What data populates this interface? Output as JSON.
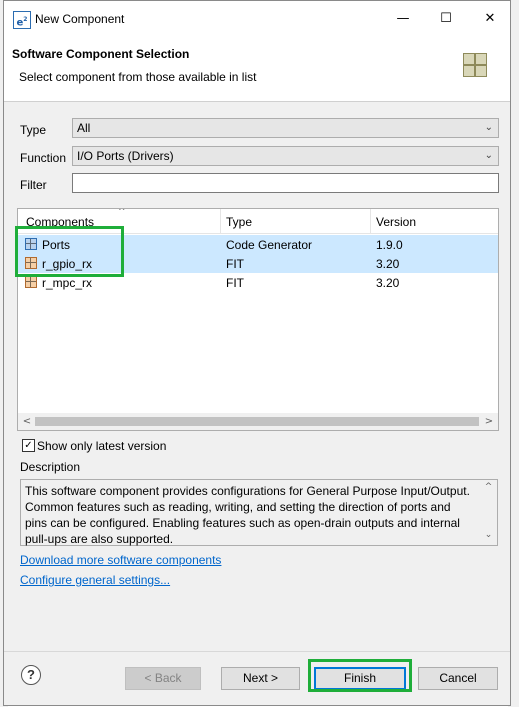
{
  "window": {
    "title": "New Component",
    "app_icon": "e²",
    "controls": {
      "minimize": "—",
      "maximize": "☐",
      "close": "✕"
    }
  },
  "header": {
    "title": "Software Component Selection",
    "description": "Select component from those available in list"
  },
  "filters": {
    "type_label": "Type",
    "type_value": "All",
    "function_label": "Function",
    "function_value": "I/O Ports (Drivers)",
    "filter_label": "Filter",
    "filter_value": ""
  },
  "table": {
    "columns": [
      "Components",
      "Type",
      "Version"
    ],
    "rows": [
      {
        "name": "Ports",
        "type": "Code Generator",
        "version": "1.9.0",
        "icon": "blue-grid-icon",
        "selected": true
      },
      {
        "name": "r_gpio_rx",
        "type": "FIT",
        "version": "3.20",
        "icon": "orange-grid-icon",
        "selected": true
      },
      {
        "name": "r_mpc_rx",
        "type": "FIT",
        "version": "3.20",
        "icon": "orange-grid-icon",
        "selected": false
      }
    ]
  },
  "show_latest": {
    "label": "Show only latest version",
    "checked": true
  },
  "description": {
    "label": "Description",
    "text": "This software component provides configurations for General Purpose Input/Output. Common features such as reading, writing, and setting the direction of ports and pins can be configured. Enabling features such as open-drain outputs and internal pull-ups are also supported."
  },
  "links": {
    "download": "Download more software components",
    "configure": "Configure general settings..."
  },
  "buttons": {
    "help": "?",
    "back": "< Back",
    "next": "Next >",
    "finish": "Finish",
    "cancel": "Cancel"
  },
  "colors": {
    "selection": "#cce8ff",
    "highlight": "#1fae3a",
    "link": "#0066cc"
  }
}
